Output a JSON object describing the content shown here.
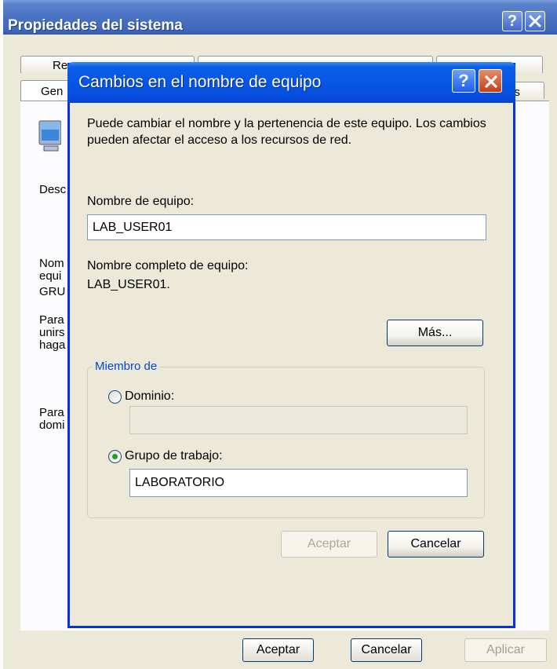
{
  "back_window": {
    "title": "Propiedades del sistema",
    "help_label": "?",
    "tabs": {
      "row1": [
        "Re",
        "",
        ""
      ],
      "row2": [
        "Gen",
        "as"
      ]
    },
    "texts": {
      "descripcion": "Desc",
      "nombre_equipo": [
        "Nom",
        "equi"
      ],
      "grupo": "GRU",
      "para_unirse": [
        "Para",
        "unirs",
        "haga"
      ],
      "para_dominio": [
        "Para",
        "domi"
      ]
    },
    "buttons": {
      "ok": "Aceptar",
      "cancel": "Cancelar",
      "apply": "Aplicar"
    }
  },
  "dialog": {
    "title": "Cambios en el nombre de equipo",
    "help_label": "?",
    "description": "Puede cambiar el nombre y la pertenencia de este equipo. Los cambios pueden afectar el acceso a los recursos de red.",
    "computer_name_label": "Nombre de equipo:",
    "computer_name_value": "LAB_USER01",
    "full_name_label": "Nombre completo de equipo:",
    "full_name_value": "LAB_USER01.",
    "more_button": "Más...",
    "member_of": {
      "label": "Miembro de",
      "domain_label": "Dominio:",
      "domain_value": "",
      "domain_selected": false,
      "workgroup_label": "Grupo de trabajo:",
      "workgroup_value": "LABORATORIO",
      "workgroup_selected": true
    },
    "ok_button": "Aceptar",
    "cancel_button": "Cancelar"
  }
}
